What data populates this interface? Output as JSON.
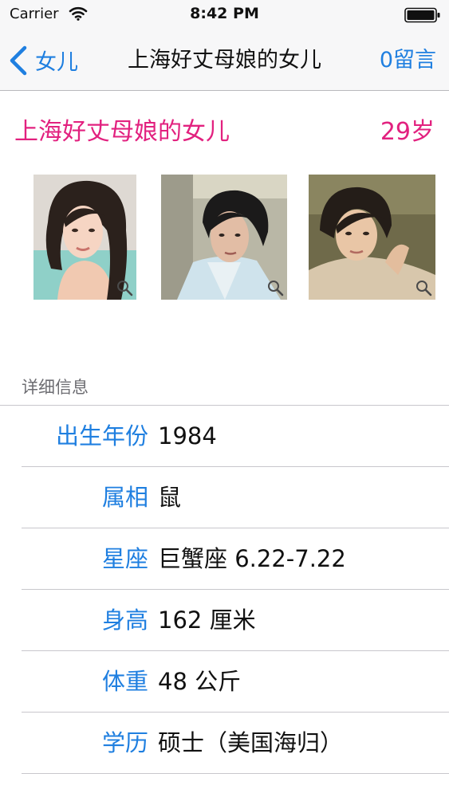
{
  "status_bar": {
    "carrier": "Carrier",
    "time": "8:42 PM",
    "wifi_icon": "wifi-icon",
    "battery_icon": "battery-icon"
  },
  "nav": {
    "back_label": "女儿",
    "back_icon": "chevron-left-icon",
    "title": "上海好丈母娘的女儿",
    "message_label": "0留言"
  },
  "profile": {
    "name": "上海好丈母娘的女儿",
    "age": "29岁"
  },
  "photos": [
    {
      "zoom_icon": "magnifier-icon"
    },
    {
      "zoom_icon": "magnifier-icon"
    },
    {
      "zoom_icon": "magnifier-icon"
    }
  ],
  "details": {
    "section_title": "详细信息",
    "rows": [
      {
        "label": "出生年份",
        "value": "1984"
      },
      {
        "label": "属相",
        "value": "鼠"
      },
      {
        "label": "星座",
        "value": "巨蟹座 6.22-7.22"
      },
      {
        "label": "身高",
        "value": "162 厘米"
      },
      {
        "label": "体重",
        "value": "48 公斤"
      },
      {
        "label": "学历",
        "value": "硕士（美国海归）"
      }
    ]
  },
  "colors": {
    "accent_blue": "#1f7fe0",
    "accent_pink": "#e2217f",
    "bar_background": "#f7f7f8",
    "separator": "#c8c7cc"
  }
}
